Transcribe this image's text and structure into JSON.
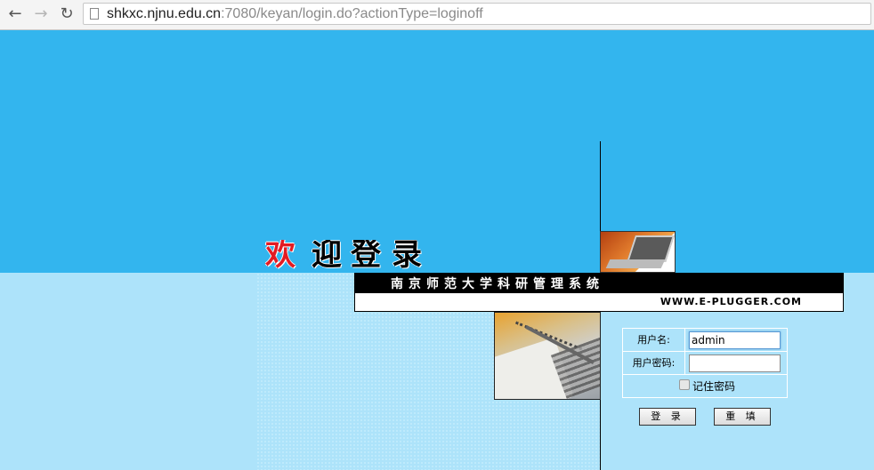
{
  "browser": {
    "url_host": "shkxc.njnu.edu.cn",
    "url_rest": ":7080/keyan/login.do?actionType=loginoff"
  },
  "page": {
    "welcome_chars": [
      "欢",
      "迎",
      "登",
      "录"
    ],
    "banner_title": "南京师范大学科研管理系统",
    "banner_url": "WWW.E-PLUGGER.COM",
    "colors": {
      "top": "#33b5ee",
      "bottom": "#ade3fa"
    }
  },
  "login": {
    "username_label": "用户名:",
    "username_value": "admin",
    "password_label": "用户密码:",
    "password_value": "",
    "remember_label": "记住密码",
    "remember_checked": false,
    "login_button": "登 录",
    "reset_button": "重 填"
  }
}
